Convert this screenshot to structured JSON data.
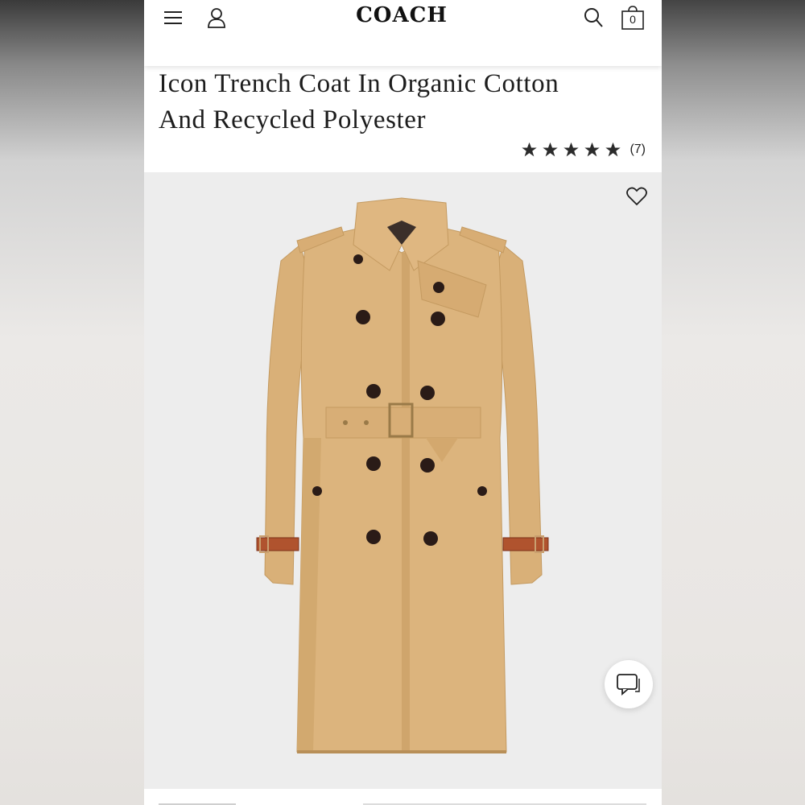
{
  "header": {
    "brand": "COACH",
    "menu_icon": "hamburger-menu-icon",
    "account_icon": "user-account-icon",
    "search_icon": "search-icon",
    "bag_icon": "shopping-bag-icon",
    "bag_count": "0"
  },
  "product": {
    "title_line1": "Icon Trench Coat In Organic Cotton",
    "title_line2": "And Recycled Polyester",
    "rating": {
      "stars": 5,
      "max_stars": 5,
      "review_count": "(7)"
    },
    "image_icon": "trench-coat-product-image",
    "wishlist_icon": "heart-icon"
  },
  "chat": {
    "icon": "chat-bubble-icon"
  },
  "colors": {
    "coat": "#dbb37c",
    "coat_shadow": "#c99d62",
    "buttons": "#2a1b17",
    "strap": "#b0532e",
    "image_bg": "#ededed",
    "text": "#1d1d1d"
  }
}
